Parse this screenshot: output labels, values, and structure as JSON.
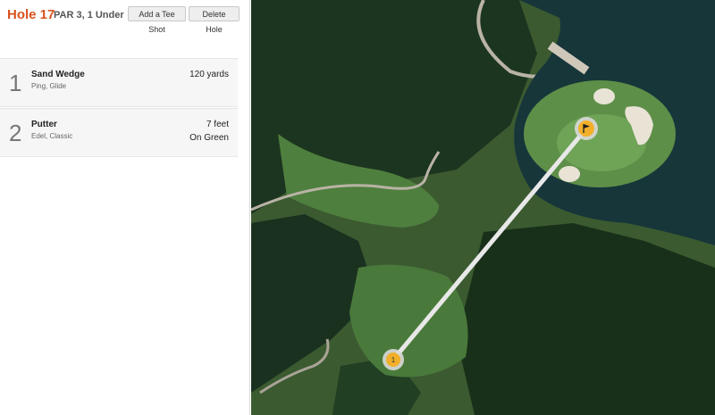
{
  "header": {
    "title": "Hole 17",
    "subtitle": "PAR 3, 1 Under",
    "add_tee_shot_label": "Add a Tee Shot",
    "delete_hole_label": "Delete Hole"
  },
  "shots": [
    {
      "number": "1",
      "club": "Sand Wedge",
      "model": "Ping, Glide",
      "distance": "120 yards",
      "result": ""
    },
    {
      "number": "2",
      "club": "Putter",
      "model": "Edel, Classic",
      "distance": "7 feet",
      "result": "On Green"
    }
  ],
  "map": {
    "tee_marker_label": "1",
    "flag_icon": "flag-icon",
    "colors": {
      "water": "#17363a",
      "fairway": "#3f6b34",
      "trees": "#173019",
      "sand": "#e9e3d6",
      "marker": "#f2b02a"
    }
  }
}
